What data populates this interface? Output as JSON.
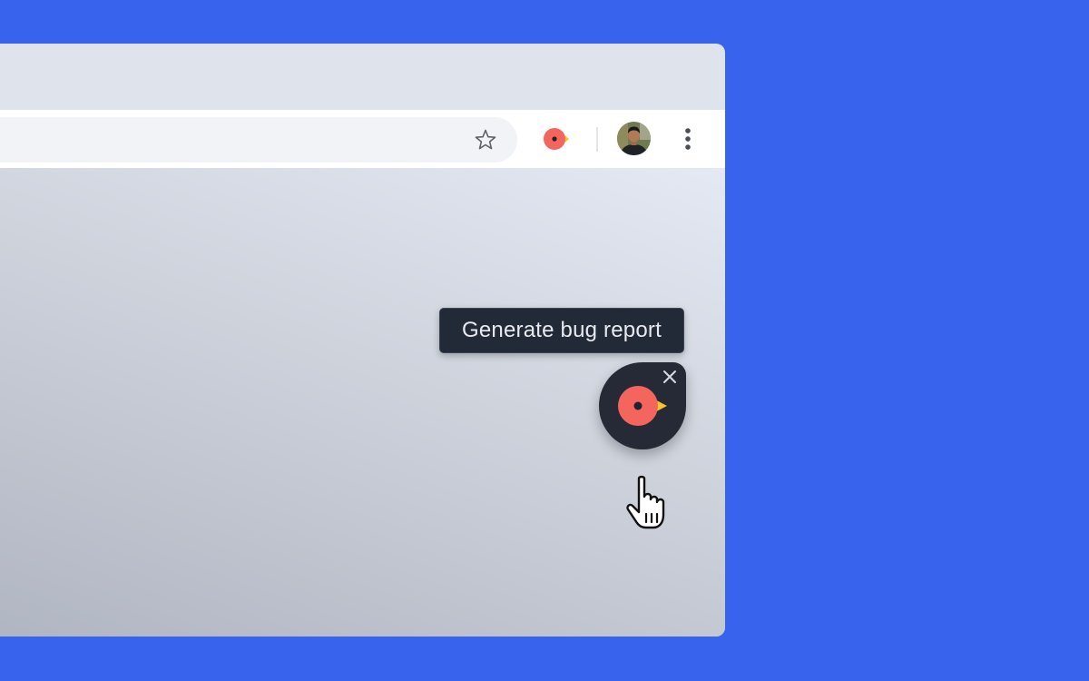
{
  "theme": {
    "background": "#3763ED",
    "logo_red": "#F4655E",
    "logo_yellow": "#F8C42A",
    "float_bg": "#252A36"
  },
  "toolbar": {
    "bookmark_icon": "star-outline-icon",
    "extension_icon": "bug-report-logo-icon",
    "avatar": "profile-avatar",
    "menu_icon": "kebab-menu-icon"
  },
  "tooltip": {
    "text": "Generate bug report"
  },
  "widget": {
    "logo_icon": "bug-report-logo-icon",
    "close_icon": "close-icon",
    "cursor_icon": "hand-pointer-icon"
  }
}
